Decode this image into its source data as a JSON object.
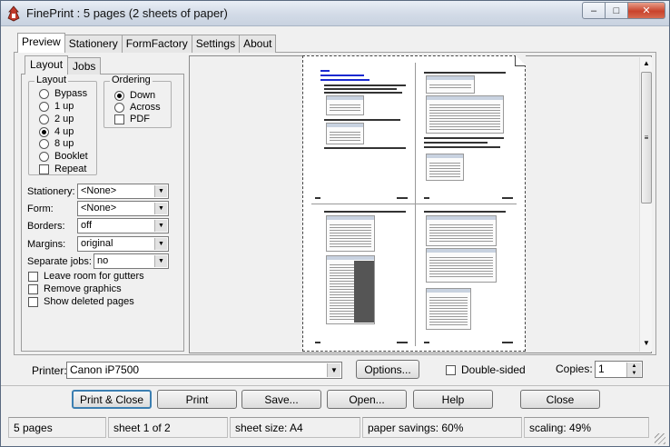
{
  "window": {
    "title": "FinePrint : 5 pages (2 sheets of paper)",
    "min_glyph": "–",
    "max_glyph": "□",
    "close_glyph": "✕"
  },
  "tabs": [
    "Preview",
    "Stationery",
    "FormFactory",
    "Settings",
    "About"
  ],
  "subtabs": [
    "Layout",
    "Jobs"
  ],
  "layout_group": {
    "title": "Layout",
    "options": [
      {
        "label": "Bypass",
        "checked": false
      },
      {
        "label": "1 up",
        "checked": false
      },
      {
        "label": "2 up",
        "checked": false
      },
      {
        "label": "4 up",
        "checked": true
      },
      {
        "label": "8 up",
        "checked": false
      },
      {
        "label": "Booklet",
        "checked": false
      }
    ],
    "repeat_label": "Repeat"
  },
  "ordering_group": {
    "title": "Ordering",
    "options": [
      {
        "label": "Down",
        "checked": true
      },
      {
        "label": "Across",
        "checked": false
      }
    ],
    "pdf_label": "PDF"
  },
  "fields": {
    "stationery": {
      "label": "Stationery:",
      "value": "<None>"
    },
    "form": {
      "label": "Form:",
      "value": "<None>"
    },
    "borders": {
      "label": "Borders:",
      "value": "off"
    },
    "margins": {
      "label": "Margins:",
      "value": "original"
    },
    "separate_jobs": {
      "label": "Separate jobs:",
      "value": "no"
    }
  },
  "checks": {
    "leave_room": "Leave room for gutters",
    "remove_graphics": "Remove graphics",
    "show_deleted": "Show deleted pages"
  },
  "printer": {
    "label": "Printer:",
    "value": "Canon iP7500",
    "options_button": "Options...",
    "double_sided": "Double-sided",
    "copies_label": "Copies:",
    "copies_value": "1"
  },
  "buttons": {
    "print_close": "Print & Close",
    "print": "Print",
    "save": "Save...",
    "open": "Open...",
    "help": "Help",
    "close": "Close"
  },
  "status": {
    "pages": "5 pages",
    "sheet": "sheet 1 of 2",
    "sheet_size": "sheet size: A4",
    "savings": "paper savings: 60%",
    "scaling": "scaling: 49%"
  },
  "colors": {
    "accent": "#3c7fb1",
    "link": "#1a2ad0"
  }
}
